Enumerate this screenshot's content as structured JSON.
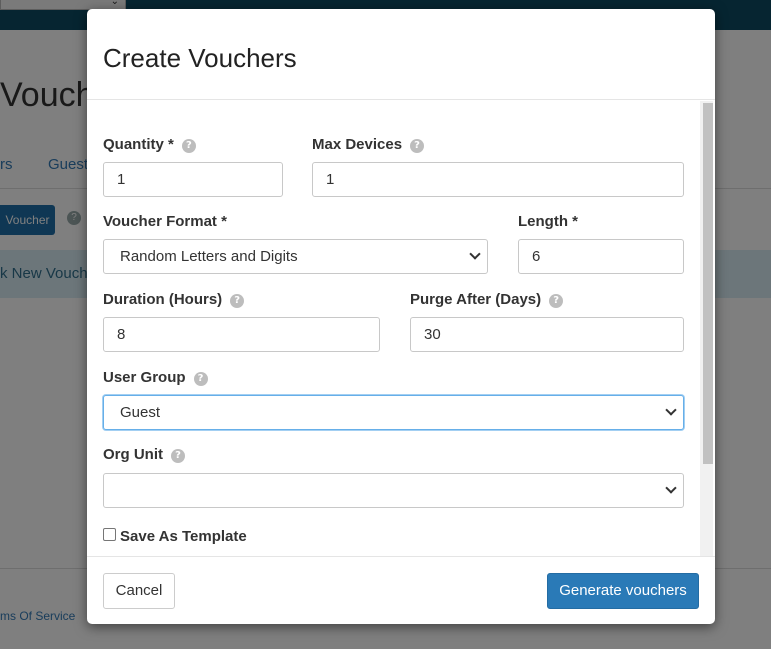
{
  "background": {
    "page_title": "Vouch",
    "tabs": [
      "rs",
      "Guest"
    ],
    "voucher_button": "Voucher",
    "info_text": "k New Vouche",
    "footer_link": "ms Of Service"
  },
  "modal": {
    "title": "Create Vouchers",
    "fields": {
      "quantity": {
        "label": "Quantity *",
        "value": "1"
      },
      "max_devices": {
        "label": "Max Devices",
        "value": "1"
      },
      "voucher_format": {
        "label": "Voucher Format *",
        "value": "Random Letters and Digits"
      },
      "length": {
        "label": "Length *",
        "value": "6"
      },
      "duration": {
        "label": "Duration (Hours)",
        "value": "8"
      },
      "purge_after": {
        "label": "Purge After (Days)",
        "value": "30"
      },
      "user_group": {
        "label": "User Group",
        "value": "Guest"
      },
      "org_unit": {
        "label": "Org Unit",
        "value": ""
      }
    },
    "save_as_template": {
      "label": "Save As Template",
      "checked": false
    },
    "buttons": {
      "cancel": "Cancel",
      "generate": "Generate vouchers"
    }
  },
  "icons": {
    "help": "?"
  },
  "colors": {
    "primary": "#2a7ab7",
    "topbar": "#0d4a63",
    "focus": "#66afe9"
  }
}
